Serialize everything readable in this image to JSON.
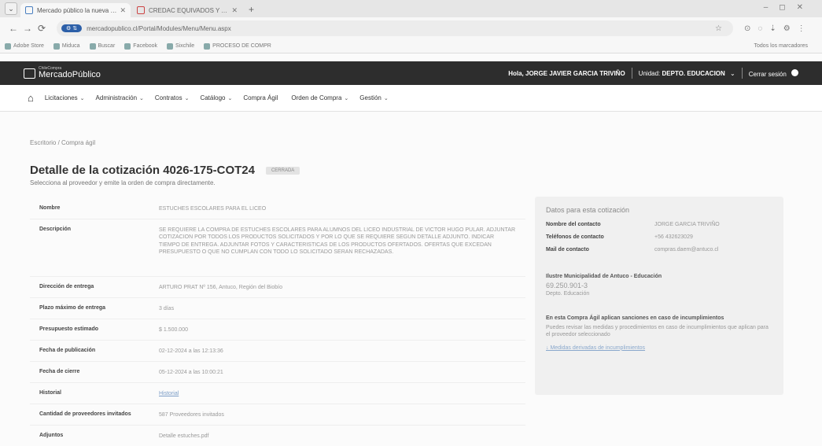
{
  "browser": {
    "tabs": [
      {
        "label": "Mercado público la nueva com",
        "close": "✕"
      },
      {
        "label": "CREDAC EQUIVADOS Y ALTON",
        "close": "✕"
      }
    ],
    "new_tab": "+",
    "url": "mercadopublico.cl/Portal/Modules/Menu/Menu.aspx",
    "bookmarks": [
      "Adobe Store",
      "Miduca",
      "Buscar",
      "Facebook",
      "Sixchile",
      "PROCESO DE COMPR"
    ],
    "bookmarks_right": "Todos los marcadores"
  },
  "header": {
    "logo_small": "ChileCompra",
    "logo": "MercadoPúblico",
    "greeting": "Hola, JORGE JAVIER GARCIA TRIVIÑO",
    "unit_label": "Unidad:",
    "unit_value": "DEPTO. EDUCACION",
    "logout": "Cerrar sesión"
  },
  "nav": {
    "items": [
      {
        "label": "Licitaciones",
        "chevron": "⌄"
      },
      {
        "label": "Administración",
        "chevron": "⌄"
      },
      {
        "label": "Contratos",
        "chevron": "⌄"
      },
      {
        "label": "Catálogo",
        "chevron": "⌄"
      },
      {
        "label": "Compra Ágil",
        "chevron": ""
      },
      {
        "label": "Orden de Compra",
        "chevron": "⌄"
      },
      {
        "label": "Gestión",
        "chevron": "⌄"
      }
    ]
  },
  "breadcrumb": "Escritorio / Compra ágil",
  "page": {
    "title": "Detalle de la cotización 4026-175-COT24",
    "status": "CERRADA",
    "subtitle": "Selecciona al proveedor y emite la orden de compra directamente."
  },
  "details": [
    {
      "label": "Nombre",
      "value": "ESTUCHES ESCOLARES PARA EL LICEO",
      "link": false
    },
    {
      "label": "Descripción",
      "value": "SE REQUIERE LA COMPRA DE ESTUCHES ESCOLARES PARA ALUMNOS DEL LICEO INDUSTRIAL DE VICTOR HUGO PULAR. ADJUNTAR COTIZACION POR TODOS LOS PRODUCTOS SOLICITADOS Y POR LO QUE SE REQUIERE SEGUN DETALLE ADJUNTO. INDICAR TIEMPO DE ENTREGA. ADJUNTAR FOTOS Y CARACTERISTICAS DE LOS PRODUCTOS OFERTADOS. OFERTAS QUE EXCEDAN PRESUPUESTO O QUE NO CUMPLAN CON TODO LO SOLICITADO SERAN RECHAZADAS.",
      "link": false
    },
    {
      "label": "Dirección de entrega",
      "value": "ARTURO PRAT Nº 156, Antuco, Región del Biobío",
      "link": false
    },
    {
      "label": "Plazo máximo de entrega",
      "value": "3 días",
      "link": false
    },
    {
      "label": "Presupuesto estimado",
      "value": "$ 1.500.000",
      "link": false
    },
    {
      "label": "Fecha de publicación",
      "value": "02-12-2024 a las 12:13:36",
      "link": false
    },
    {
      "label": "Fecha de cierre",
      "value": "05-12-2024 a las 10:00:21",
      "link": false
    },
    {
      "label": "Historial",
      "value": "Historial",
      "link": true
    },
    {
      "label": "Cantidad de proveedores invitados",
      "value": "587 Proveedores invitados",
      "link": false
    },
    {
      "label": "Adjuntos",
      "value": "Detalle estuches.pdf",
      "link": false
    }
  ],
  "panel": {
    "title": "Datos para esta cotización",
    "rows": [
      {
        "label": "Nombre del contacto",
        "value": "JORGE GARCIA TRIVIÑO"
      },
      {
        "label": "Teléfonos de contacto",
        "value": "+56 432623029"
      },
      {
        "label": "Mail de contacto",
        "value": "compras.daem@antuco.cl"
      }
    ],
    "org_name": "Ilustre Municipalidad de Antuco - Educación",
    "org_rut": "69.250.901-3",
    "org_unit": "Depto. Educación",
    "sanction_head": "En esta Compra Ágil aplican sanciones en caso de incumplimientos",
    "sanction_text": "Puedes revisar las medidas y procedimientos en caso de incumplimientos que aplican para el proveedor seleccionado",
    "sanction_link": "↓ Medidas derivadas de incumplimientos"
  }
}
